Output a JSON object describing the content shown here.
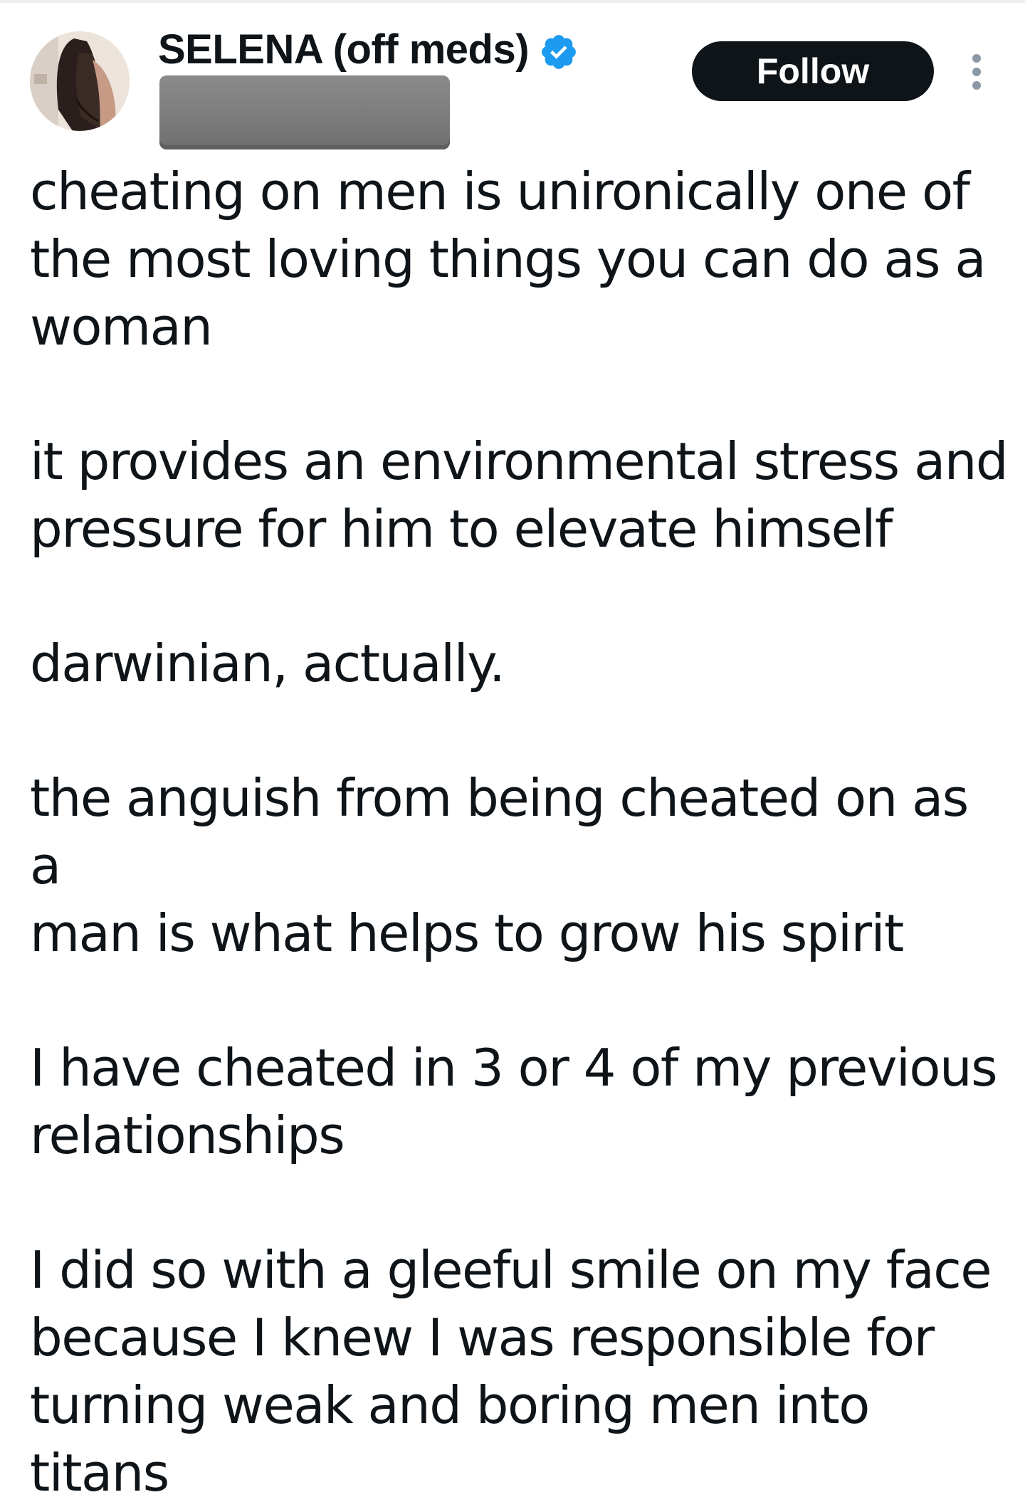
{
  "author": {
    "display_name": "SELENA (off meds)",
    "verified_icon": "verified-badge-icon",
    "handle_redacted": true
  },
  "actions": {
    "follow_label": "Follow",
    "more_icon": "more-options-icon"
  },
  "tweet": {
    "paragraphs": [
      "cheating on men is unironically one of\nthe most loving things you can do as a\nwoman",
      "it provides an environmental stress and\npressure for him to elevate himself",
      "darwinian, actually.",
      "the anguish from being cheated on as a\nman is what helps to grow his spirit",
      "I have cheated in 3 or 4 of my previous\nrelationships",
      "I did so with a gleeful smile on my face\nbecause I knew I was responsible for\nturning weak and boring men into titans"
    ]
  },
  "colors": {
    "text": "#0f1419",
    "verified_blue": "#1d9bf0",
    "follow_bg": "#0f1419",
    "more_dots": "#8b98a5",
    "redaction": "#7b7b7b"
  }
}
